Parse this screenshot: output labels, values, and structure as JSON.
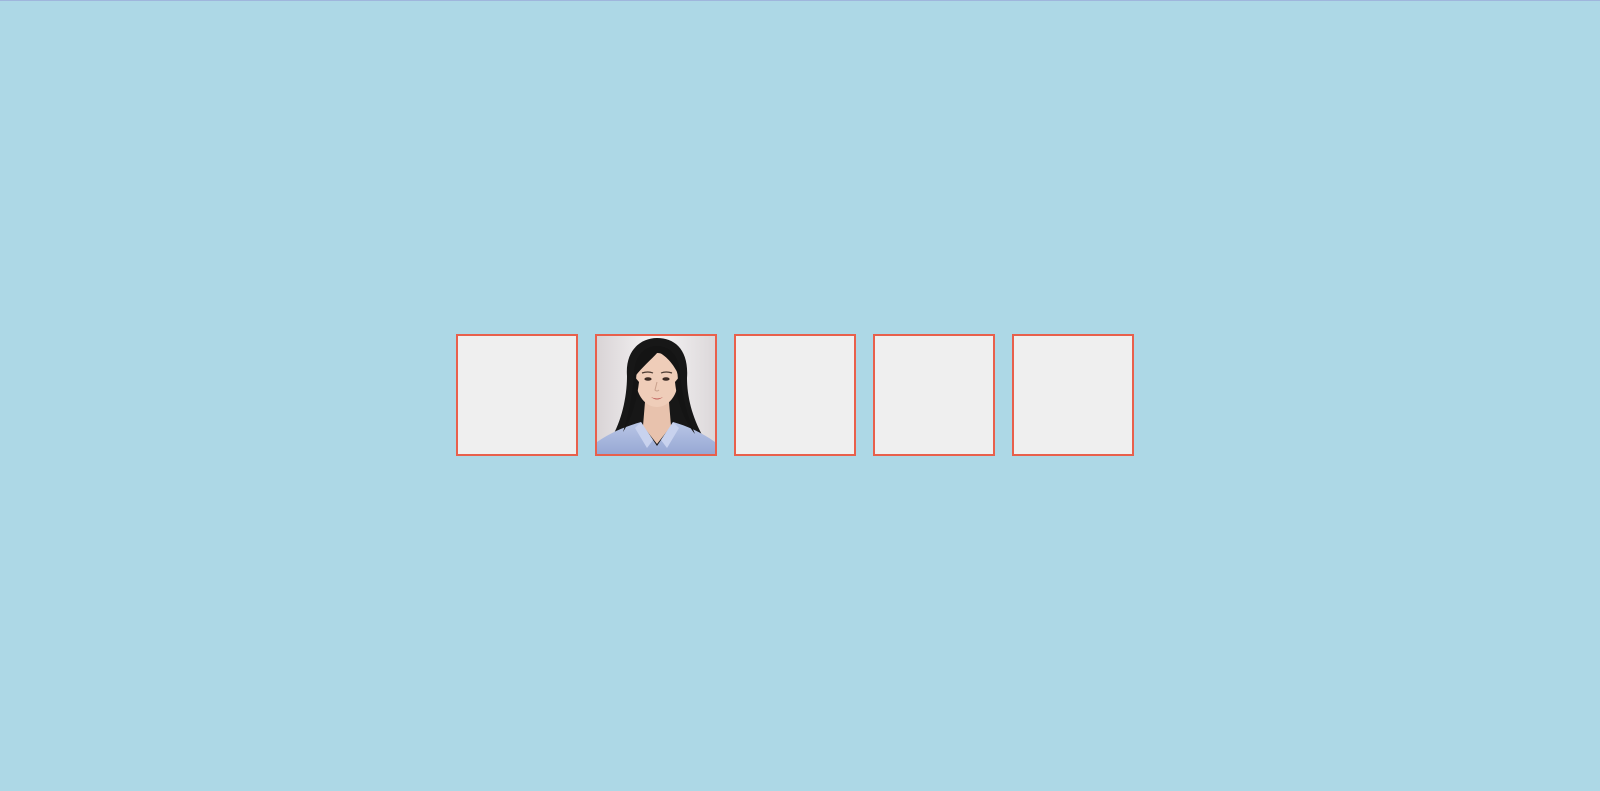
{
  "page": {
    "background_color": "#add8e6"
  },
  "tiles": [
    {
      "state": "empty"
    },
    {
      "state": "revealed",
      "image": "portrait-photo"
    },
    {
      "state": "empty"
    },
    {
      "state": "empty"
    },
    {
      "state": "empty"
    }
  ],
  "colors": {
    "tile_border": "#e8604c",
    "tile_fill": "#efefef"
  }
}
